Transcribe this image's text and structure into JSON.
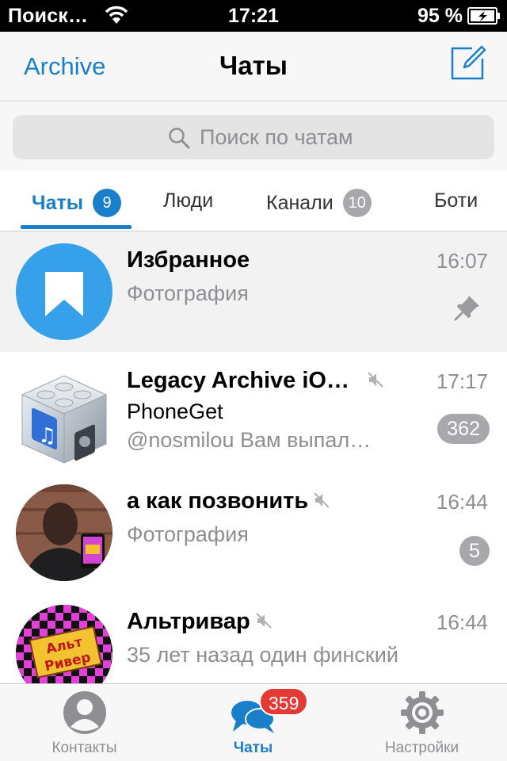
{
  "status_bar": {
    "carrier": "Поиск…",
    "time": "17:21",
    "battery_percent": "95 %"
  },
  "nav": {
    "back_label": "Archive",
    "title": "Чаты",
    "compose_icon": "compose-icon"
  },
  "search": {
    "placeholder": "Поиск по чатам"
  },
  "filter_tabs": [
    {
      "label": "Чаты",
      "badge": "9",
      "active": true
    },
    {
      "label": "Люди",
      "badge": ""
    },
    {
      "label": "Канали",
      "badge": "10"
    },
    {
      "label": "Боти",
      "badge": ""
    }
  ],
  "chats": [
    {
      "name": "Избранное",
      "time": "16:07",
      "preview": "Фотография",
      "pinned": true,
      "avatar": "bookmark-avatar"
    },
    {
      "name": "Legacy Archive iO…",
      "time": "17:17",
      "sender": "PhoneGet",
      "preview": "@nosmilou Вам выпал…",
      "muted": true,
      "unread": "362",
      "avatar": "itunes-avatar"
    },
    {
      "name": "а как позвонить",
      "time": "16:44",
      "preview": "Фотография",
      "muted": true,
      "unread": "5",
      "avatar": "person-photo-avatar"
    },
    {
      "name": "Альтривар",
      "time": "16:44",
      "preview": "35 лет назад один финский",
      "muted": true,
      "avatar": "altrivar-avatar",
      "avatar_text": [
        "Альт",
        "Ривер"
      ]
    }
  ],
  "tab_bar": [
    {
      "label": "Контакты",
      "icon": "contacts-icon"
    },
    {
      "label": "Чаты",
      "icon": "chats-icon",
      "badge": "359",
      "active": true
    },
    {
      "label": "Настройки",
      "icon": "settings-icon"
    }
  ],
  "colors": {
    "accent": "#1a7fc9",
    "badge_red": "#e53935",
    "badge_grey": "#a7a7ac"
  }
}
